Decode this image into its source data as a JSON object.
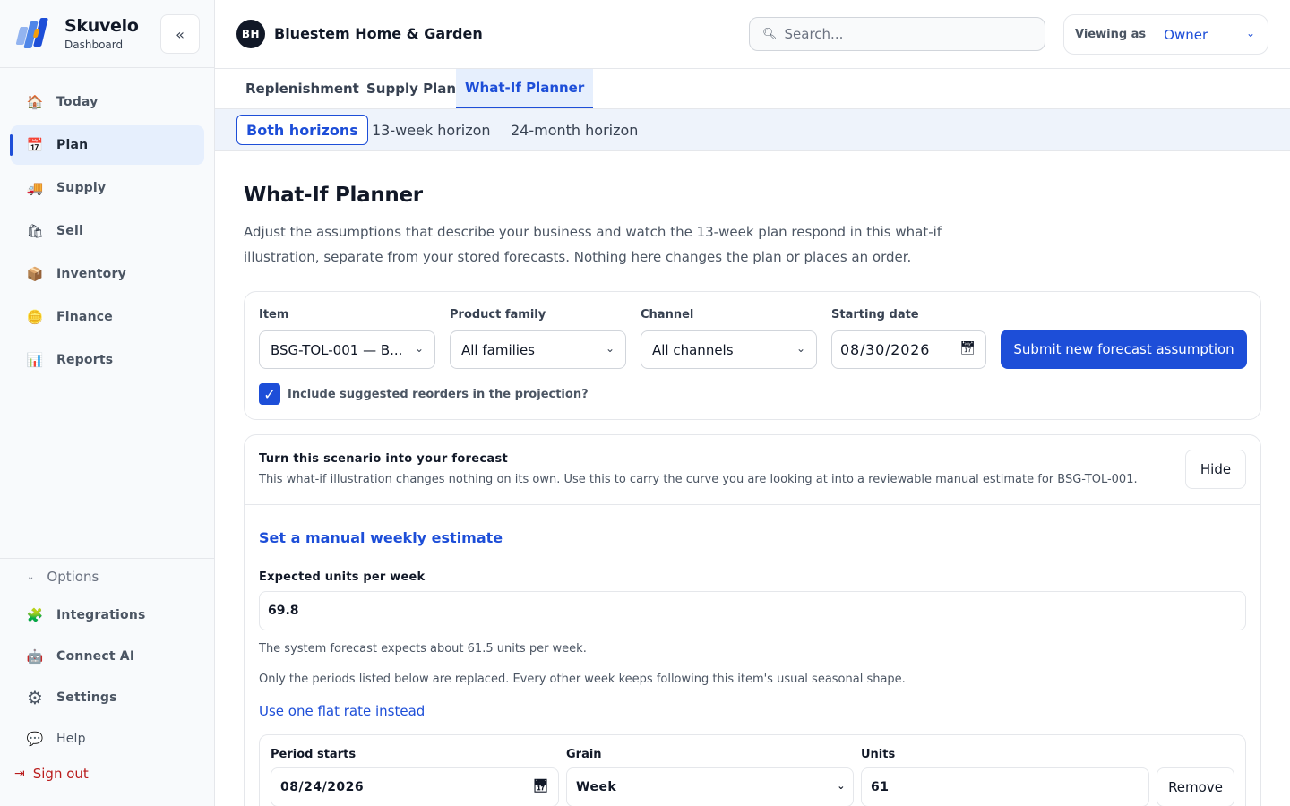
{
  "brand": {
    "name": "Skuvelo",
    "subtitle": "Dashboard",
    "collapse_icon": "«",
    "logo_colors": [
      "#4f86e8",
      "#1d4ed8",
      "#f59e0b",
      "#93b4f0"
    ]
  },
  "sidebar": {
    "items": [
      {
        "label": "Today",
        "icon": "🏠",
        "icon_name": "house-icon",
        "active": false
      },
      {
        "label": "Plan",
        "icon": "📅",
        "icon_name": "calendar-icon",
        "active": true
      },
      {
        "label": "Supply",
        "icon": "🚚",
        "icon_name": "truck-icon",
        "active": false
      },
      {
        "label": "Sell",
        "icon": "🛍",
        "icon_name": "shopping-bag-icon",
        "active": false
      },
      {
        "label": "Inventory",
        "icon": "📦",
        "icon_name": "package-icon",
        "active": false
      },
      {
        "label": "Finance",
        "icon": "🪙",
        "icon_name": "coin-icon",
        "active": false
      },
      {
        "label": "Reports",
        "icon": "📊",
        "icon_name": "chart-icon",
        "active": false
      }
    ],
    "options_label": "Options",
    "options_items": [
      {
        "label": "Integrations",
        "icon": "🧩",
        "icon_name": "puzzle-icon"
      },
      {
        "label": "Connect AI",
        "icon": "🤖",
        "icon_name": "robot-icon"
      },
      {
        "label": "Settings",
        "icon": "⚙",
        "icon_name": "gear-icon"
      },
      {
        "label": "Help",
        "icon": "💬",
        "icon_name": "speech-bubble-icon"
      }
    ],
    "sign_out": "Sign out"
  },
  "header": {
    "org_initials": "BH",
    "org_name": "Bluestem Home & Garden",
    "search_placeholder": "Search...",
    "viewing_label": "Viewing as",
    "viewing_value": "Owner"
  },
  "tabs": [
    "Replenishment",
    "Supply Plan",
    "What-If Planner"
  ],
  "active_tab": "What-If Planner",
  "horizons": [
    "Both horizons",
    "13-week horizon",
    "24-month horizon"
  ],
  "active_horizon": "Both horizons",
  "main": {
    "title": "What-If Planner",
    "description": "Adjust the assumptions that describe your business and watch the 13-week plan respond in this what-if illustration, separate from your stored forecasts. Nothing here changes the plan or places an order."
  },
  "filters": {
    "item_label": "Item",
    "item_value": "BSG-TOL-001 — B...",
    "family_label": "Product family",
    "family_value": "All families",
    "channel_label": "Channel",
    "channel_value": "All channels",
    "date_label": "Starting date",
    "date_value": "08/30/2026",
    "submit_label": "Submit new forecast assumption",
    "include_label": "Include suggested reorders in the projection?",
    "include_checked": true
  },
  "scenario": {
    "title": "Turn this scenario into your forecast",
    "subtitle": "This what-if illustration changes nothing on its own. Use this to carry the curve you are looking at into a reviewable manual estimate for BSG-TOL-001.",
    "hide_label": "Hide",
    "manual_title": "Set a manual weekly estimate",
    "units_label": "Expected units per week",
    "units_value": "69.8",
    "system_note": "The system forecast expects about 61.5 units per week.",
    "periods_note": "Only the periods listed below are replaced. Every other week keeps following this item's usual seasonal shape.",
    "flat_link": "Use one flat rate instead",
    "period": {
      "starts_label": "Period starts",
      "starts_value": "08/24/2026",
      "grain_label": "Grain",
      "grain_value": "Week",
      "units_label": "Units",
      "units_value": "61",
      "remove_label": "Remove"
    }
  },
  "colors": {
    "accent": "#1d4ed8",
    "danger": "#b91c1c",
    "active_bg": "#e6effd"
  }
}
